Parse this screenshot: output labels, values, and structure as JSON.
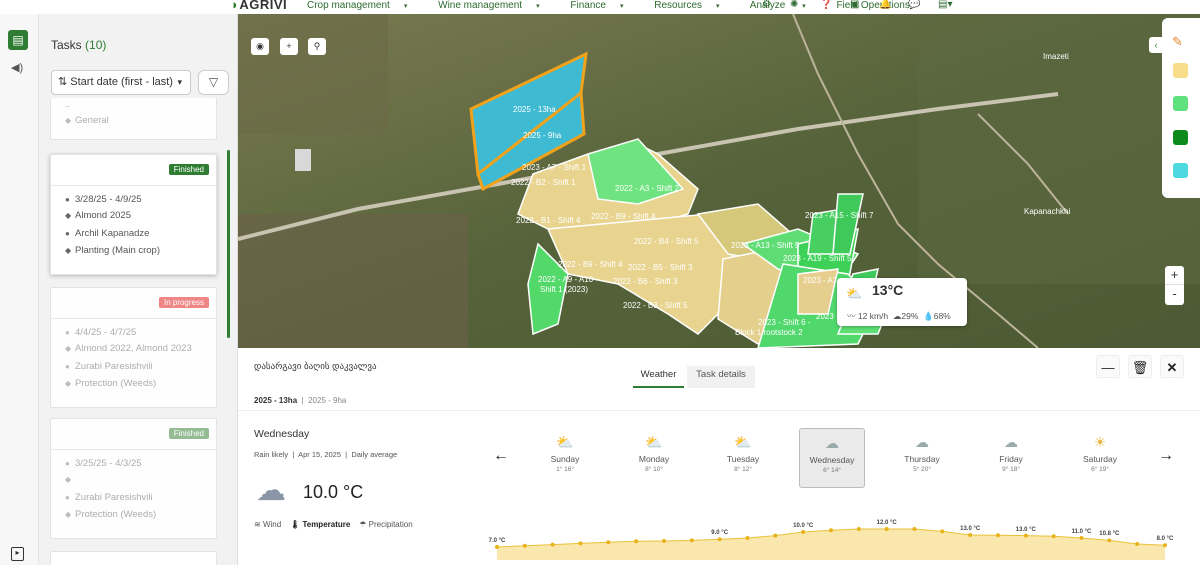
{
  "brand": {
    "logo_text": "AGRIVI"
  },
  "top_nav": {
    "items": [
      "Crop management",
      "Wine management",
      "Finance",
      "Resources",
      "Analyze",
      "Field Operations"
    ],
    "icons": [
      "gear-icon",
      "sun-icon",
      "help-icon",
      "calendar-icon",
      "bell-icon",
      "chat-icon",
      "buildings-icon"
    ]
  },
  "sidebar": {
    "icons": [
      "clipboard-icon",
      "speaker-icon",
      "expand-icon"
    ]
  },
  "tasks": {
    "title": "Tasks",
    "count": "(10)",
    "sort_label": "Start date (first - last)",
    "cards": [
      {
        "status": "",
        "date": "",
        "fields": "",
        "assignee": "",
        "type": "General"
      },
      {
        "status": "Finished",
        "date": "3/28/25 - 4/9/25",
        "fields": "Almond 2025",
        "assignee": "Archil Kapanadze",
        "type": "Planting (Main crop)"
      },
      {
        "status": "In progress",
        "date": "4/4/25 - 4/7/25",
        "fields": "Almond 2022, Almond 2023",
        "assignee": "Zurabi Paresishvili",
        "type": "Protection (Weeds)"
      },
      {
        "status": "Finished",
        "date": "3/25/25 - 4/3/25",
        "fields": "",
        "assignee": "Zurabi Paresishvili",
        "type": "Protection (Weeds)"
      }
    ]
  },
  "map": {
    "field_labels": [
      "2025 - 13ha",
      "2025 - 9ha",
      "2023 - A7 - Shift 1",
      "2022 - B2 - Shift 1",
      "2022 - A3 - Shift 2",
      "2022 - B9 - Shift 4",
      "2022 - B1 - Shift 4",
      "2022 - B4 - Shift 5",
      "2023 - A15 - Shift 7",
      "2023 - A13 - Shift 5",
      "2023 - A19 - Shift 5",
      "2022 - B9 - Shift 4",
      "2022 - B5 - Shift 3",
      "2022 - B6 - Shift 3",
      "2022 - A9 - A10",
      "Shift 1 (2023)",
      "2022 - B3 - Shift 5",
      "2023 - Shift 6 -",
      "Block 1 rootstock 2",
      "2023 - A7",
      "2023 - A"
    ],
    "place_labels": [
      "Kapanachkhi",
      "Imazeti"
    ],
    "zoom_in": "+",
    "zoom_out": "-",
    "legend_colors": [
      "#f7dd8a",
      "#5fe27e",
      "#0c8a1c",
      "#4ed8df"
    ],
    "weather_popup": {
      "temp": "13°C",
      "wind": "12 km/h",
      "cloud": "29%",
      "humidity": "68%"
    }
  },
  "panel": {
    "title": "დასარგავი ბაღის დაკვალვა",
    "tabs": [
      "Weather",
      "Task details"
    ],
    "field_active": "2025 - 13ha",
    "field_other": "2025 - 9ha",
    "day_name": "Wednesday",
    "day_meta": [
      "Rain likely",
      "Apr 15, 2025",
      "Daily average"
    ],
    "current_temp": "10.0 °C",
    "metrics": [
      "Wind",
      "Temperature",
      "Precipitation"
    ],
    "days": [
      {
        "name": "Sunday",
        "range": "1° 16°",
        "icon": "partly-sunny-icon"
      },
      {
        "name": "Monday",
        "range": "8° 10°",
        "icon": "cloudy-icon"
      },
      {
        "name": "Tuesday",
        "range": "8° 12°",
        "icon": "partly-sunny-icon"
      },
      {
        "name": "Wednesday",
        "range": "6° 14°",
        "icon": "rain-icon"
      },
      {
        "name": "Thursday",
        "range": "5° 20°",
        "icon": "cloud-icon"
      },
      {
        "name": "Friday",
        "range": "9° 18°",
        "icon": "cloud-icon"
      },
      {
        "name": "Saturday",
        "range": "6° 19°",
        "icon": "sun-icon"
      }
    ],
    "prev_arrow": "←",
    "next_arrow": "→"
  },
  "chart_data": {
    "type": "area",
    "series": [
      {
        "values": [
          7.0,
          7.4,
          7.8,
          8.2,
          8.6,
          8.9,
          9.0,
          9.2,
          9.6,
          10.0,
          10.8,
          12.0,
          12.6,
          13.0,
          13.0,
          13.0,
          12.2,
          11.0,
          10.9,
          10.8,
          10.6,
          10.0,
          9.2,
          8.0,
          7.6
        ]
      }
    ],
    "data_labels": [
      "7.0 °C",
      "9.0 °C",
      "10.0 °C",
      "12.0 °C",
      "13.0 °C",
      "13.0 °C",
      "11.0 °C",
      "10.8 °C",
      "8.0 °C"
    ],
    "color": "#f7dd8a"
  }
}
